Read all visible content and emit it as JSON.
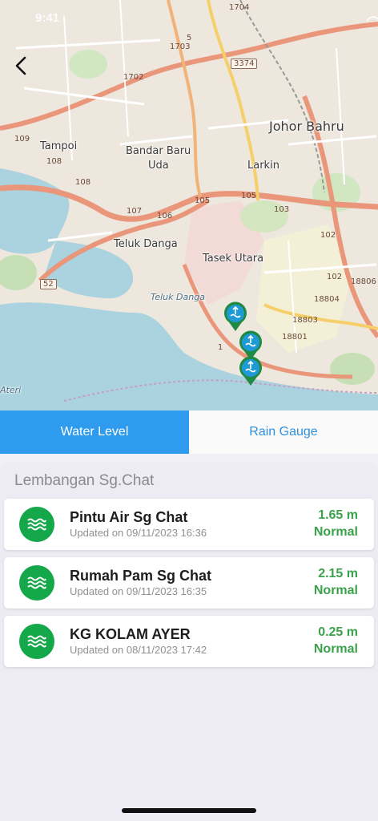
{
  "status_bar": {
    "time": "9:41"
  },
  "map": {
    "labels": [
      "Johor Bahru",
      "Tampoi",
      "Bandar Baru",
      "Uda",
      "Larkin",
      "Teluk Danga",
      "Tasek Utara",
      "Teluk Danga",
      "Ateri"
    ],
    "road_numbers": [
      "1704",
      "1703",
      "1702",
      "3374",
      "109",
      "108",
      "108",
      "107",
      "106",
      "105",
      "105",
      "103",
      "102",
      "18806",
      "18804",
      "102",
      "18803",
      "18801",
      "52",
      "1",
      "5"
    ],
    "marker_color": "#1f9ad6"
  },
  "tabs": {
    "water_level": "Water Level",
    "rain_gauge": "Rain Gauge"
  },
  "section_title": "Lembangan Sg.Chat",
  "stations": [
    {
      "name": "Pintu Air Sg Chat",
      "updated": "Updated on 09/11/2023 16:36",
      "level": "1.65 m",
      "status": "Normal"
    },
    {
      "name": "Rumah Pam Sg Chat",
      "updated": "Updated on 09/11/2023 16:35",
      "level": "2.15 m",
      "status": "Normal"
    },
    {
      "name": "KG KOLAM AYER",
      "updated": "Updated on 08/11/2023 17:42",
      "level": "0.25 m",
      "status": "Normal"
    }
  ],
  "colors": {
    "accent": "#2f9bee",
    "status_green": "#3aa24a",
    "icon_green": "#14a84a"
  },
  "icons": {
    "back": "chevron-left-icon",
    "station": "water-waves-icon",
    "marker": "water-level-marker-icon"
  }
}
